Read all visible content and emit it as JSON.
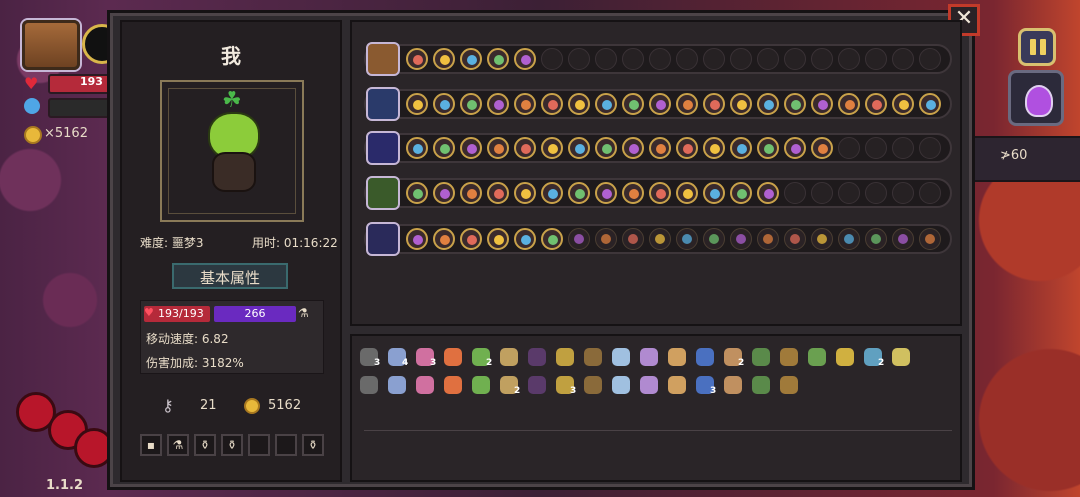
{
  "hud": {
    "hp_text": "193",
    "coins": "×5162",
    "version": "1.1.2",
    "right_panel_text": "≯60"
  },
  "dialog": {
    "close_label": "✕"
  },
  "character": {
    "name": "我",
    "difficulty": "难度: 噩梦3",
    "time": "用时: 01:16:22",
    "section_title": "基本属性",
    "hp": "193/193",
    "mp": "266",
    "move_speed": "移动速度: 6.82",
    "damage_bonus": "伤害加成: 3182%",
    "keys": "21",
    "coins": "5162",
    "inventory": [
      "▪",
      "⚗",
      "⚱",
      "⚱",
      "",
      "",
      "⚱"
    ]
  },
  "colors": {
    "accent_gold": "#c9a24a",
    "hp_red": "#b52a3a",
    "mp_purple": "#6a2ac0",
    "close_red": "#c23a2a"
  },
  "weapons": [
    {
      "icon": "chest-icon",
      "filled": 5,
      "faded": 0,
      "total": 20
    },
    {
      "icon": "spear-icon",
      "filled": 20,
      "faded": 0,
      "total": 20
    },
    {
      "icon": "staff-icon",
      "filled": 16,
      "faded": 0,
      "total": 20
    },
    {
      "icon": "book-green-icon",
      "filled": 14,
      "faded": 0,
      "total": 20
    },
    {
      "icon": "book-blue-icon",
      "filled": 6,
      "faded": 14,
      "total": 20
    }
  ],
  "passives": {
    "row1": [
      "skull",
      "wings",
      "fang",
      "heart",
      "leaf",
      "scroll",
      "hat",
      "branch",
      "cheese",
      "key",
      "cup",
      "pickaxe",
      "gem",
      "map",
      "helmet",
      "vase",
      "orb",
      "bow",
      "clock",
      "cone"
    ],
    "row1_counts": [
      "3",
      "4",
      "3",
      "",
      "2",
      "",
      "",
      "",
      "",
      "",
      "",
      "",
      "",
      "2",
      "",
      "",
      "",
      "",
      "2",
      ""
    ],
    "row2": [
      "glasses",
      "clover",
      "shield",
      "bird",
      "diamond",
      "ring",
      "brain",
      "sword",
      "sprout",
      "lotus",
      "scroll2",
      "witch-hat",
      "hood",
      "feather",
      "cape",
      "pendant"
    ],
    "row2_counts": [
      "",
      "",
      "",
      "",
      "",
      "2",
      "",
      "3",
      "",
      "",
      "",
      "",
      "3",
      "",
      "",
      ""
    ]
  }
}
